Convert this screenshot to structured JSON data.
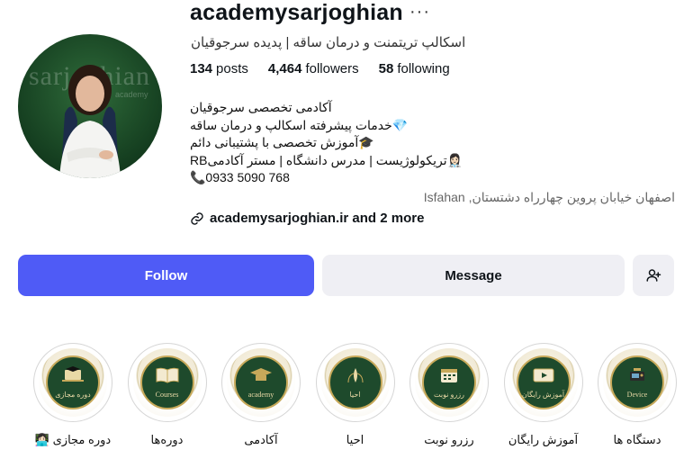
{
  "profile": {
    "username": "academysarjoghian",
    "subtitle": "اسکالپ تریتمنت و درمان ساقه | پدیده سرجوقیان",
    "avatar_watermark": "sarjoghian",
    "avatar_watermark_small": "academy",
    "more_icon": "more-dots-icon"
  },
  "stats": {
    "posts_count": "134",
    "posts_label": "posts",
    "followers_count": "4,464",
    "followers_label": "followers",
    "following_count": "58",
    "following_label": "following"
  },
  "bio": {
    "line1": "آکادمی تخصصی سرجوقیان",
    "line2": "💎خدمات پیشرفته اسکالپ و درمان ساقه",
    "line3": "🎓آموزش تخصصی با پشتیبانی دائم",
    "line4": "👩🏻‍⚕️تریکولوژیست | مدرس دانشگاه | مستر آکادمیRB",
    "line5": "📞0933 5090 768"
  },
  "location": "اصفهان خیابان پروین چهارراه دشتستان, Isfahan",
  "link": {
    "icon": "link-icon",
    "text": "academysarjoghian.ir and 2 more"
  },
  "buttons": {
    "follow": "Follow",
    "message": "Message",
    "add_user_icon": "add-user-icon"
  },
  "colors": {
    "follow_bg": "#4f5bf6",
    "secondary_bg": "#efeff4",
    "highlight_green": "#1e4a2c",
    "highlight_gold": "#c7a95a"
  },
  "highlights": [
    {
      "label": "دوره مجازی 👩🏻‍💻",
      "caption": "دوره مجازی",
      "icon": "laptop-cap-icon"
    },
    {
      "label": "دوره‌ها",
      "caption": "Courses",
      "icon": "book-icon"
    },
    {
      "label": "آکادمی",
      "caption": "academy",
      "icon": "cap-icon"
    },
    {
      "label": "احیا",
      "caption": "احیا",
      "icon": "hair-icon"
    },
    {
      "label": "رزرو نوبت",
      "caption": "رزرو نوبت",
      "icon": "calendar-icon"
    },
    {
      "label": "آموزش رایگان",
      "caption": "آموزش رایگان",
      "icon": "video-icon"
    },
    {
      "label": "دستگاه ها",
      "caption": "Device",
      "icon": "device-icon"
    }
  ]
}
